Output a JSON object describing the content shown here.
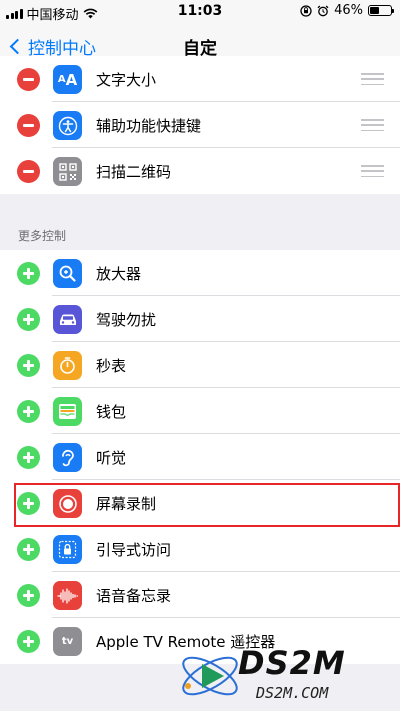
{
  "status_bar": {
    "carrier": "中国移动",
    "time": "11:03",
    "battery_percent": "46%",
    "battery_level": 0.46
  },
  "nav": {
    "back_label": "控制中心",
    "title": "自定"
  },
  "included": [
    {
      "label": "文字大小",
      "icon": "text-size-icon",
      "color": "#1a7cf5"
    },
    {
      "label": "辅助功能快捷键",
      "icon": "accessibility-icon",
      "color": "#1a7cf5"
    },
    {
      "label": "扫描二维码",
      "icon": "qr-code-icon",
      "color": "#8e8e93"
    }
  ],
  "more_controls": {
    "header": "更多控制",
    "items": [
      {
        "label": "放大器",
        "icon": "magnifier-icon",
        "color": "#1a7cf5"
      },
      {
        "label": "驾驶勿扰",
        "icon": "car-icon",
        "color": "#5856d6"
      },
      {
        "label": "秒表",
        "icon": "stopwatch-icon",
        "color": "#f5a623"
      },
      {
        "label": "钱包",
        "icon": "wallet-icon",
        "color": "#4cd964"
      },
      {
        "label": "听觉",
        "icon": "ear-icon",
        "color": "#1a7cf5"
      },
      {
        "label": "屏幕录制",
        "icon": "screen-record-icon",
        "color": "#e8403a"
      },
      {
        "label": "引导式访问",
        "icon": "lock-icon",
        "color": "#1a7cf5"
      },
      {
        "label": "语音备忘录",
        "icon": "voice-memo-icon",
        "color": "#e8403a"
      },
      {
        "label": "Apple TV Remote 遥控器",
        "icon": "apple-tv-icon",
        "color": "#8e8e93"
      }
    ]
  },
  "watermark": {
    "logo": "DS2M",
    "domain": "DS2M.COM"
  }
}
